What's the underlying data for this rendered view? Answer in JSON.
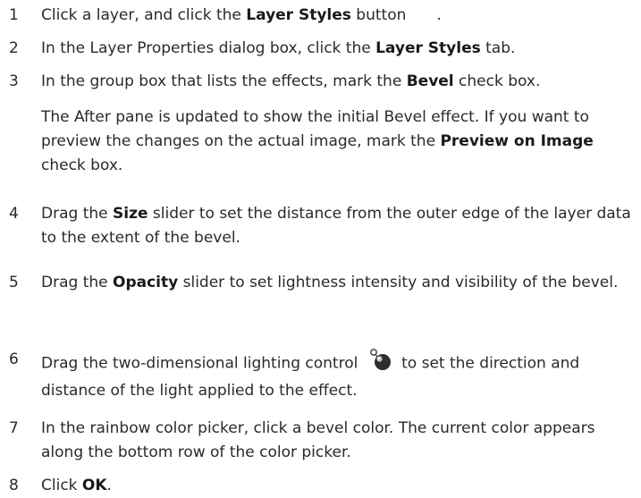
{
  "steps": [
    {
      "num": "1",
      "parts": [
        "Click a layer, and click the ",
        "Layer Styles",
        " button",
        "."
      ]
    },
    {
      "num": "2",
      "parts": [
        "In the Layer Properties dialog box, click the ",
        "Layer Styles",
        " tab."
      ]
    },
    {
      "num": "3",
      "parts": [
        "In the group box that lists the effects, mark the ",
        "Bevel",
        " check box."
      ]
    },
    {
      "note_parts": [
        "The After pane is updated to show the initial Bevel effect. If you want to preview the changes on the actual image, mark the ",
        "Preview on Image",
        " check box."
      ]
    },
    {
      "num": "4",
      "parts": [
        "Drag the ",
        "Size",
        " slider to set the distance from the outer edge of the layer data to the extent of the bevel."
      ]
    },
    {
      "num": "5",
      "parts": [
        "Drag the ",
        "Opacity",
        " slider to set lightness intensity and visibility of the bevel."
      ]
    },
    {
      "num": "6",
      "parts": [
        "Drag the two-dimensional lighting control ",
        " to set the direction and distance of the light applied to the effect."
      ]
    },
    {
      "num": "7",
      "parts": [
        "In the rainbow color picker, click a bevel color. The current color appears along the bottom row of the color picker."
      ]
    },
    {
      "num": "8",
      "parts": [
        "Click ",
        "OK",
        "."
      ]
    }
  ],
  "icons": {
    "layer_styles_button": "layer-styles-icon",
    "lighting_control": "lighting-control-icon"
  }
}
